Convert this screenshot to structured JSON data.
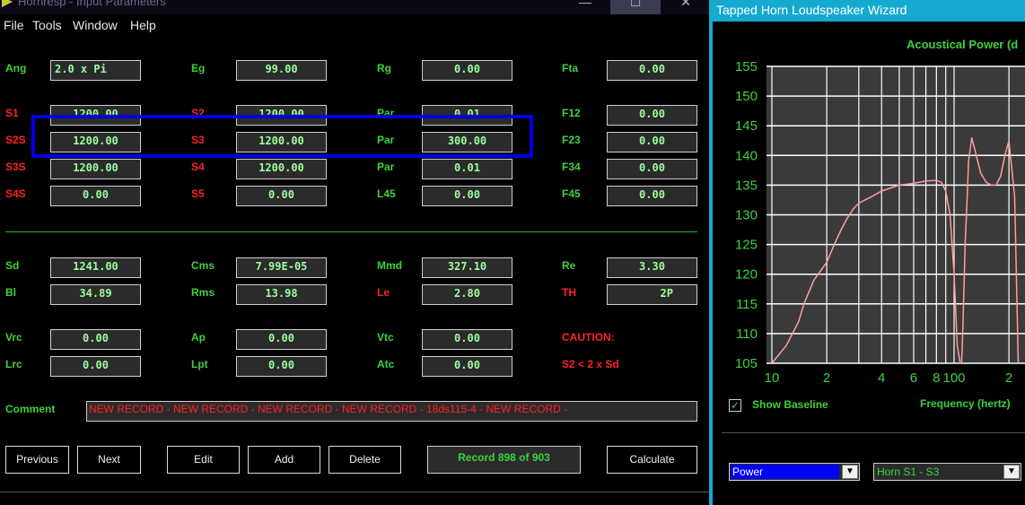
{
  "window": {
    "title": "Hornresp - Input Parameters",
    "min_glyph": "—",
    "max_glyph": "☐",
    "close_glyph": "✕"
  },
  "menu": [
    "File",
    "Tools",
    "Window",
    "Help"
  ],
  "params": {
    "ang": {
      "label": "Ang",
      "value": "2.0 x Pi"
    },
    "eg": {
      "label": "Eg",
      "value": "99.00"
    },
    "rg": {
      "label": "Rg",
      "value": "0.00"
    },
    "fta": {
      "label": "Fta",
      "value": "0.00"
    },
    "s1": {
      "label": "S1",
      "value": "1200.00"
    },
    "s2": {
      "label": "S2",
      "value": "1200.00"
    },
    "par1": {
      "label": "Par",
      "value": "0.01"
    },
    "f12": {
      "label": "F12",
      "value": "0.00"
    },
    "s2s": {
      "label": "S2S",
      "value": "1200.00"
    },
    "s3": {
      "label": "S3",
      "value": "1200.00"
    },
    "par2": {
      "label": "Par",
      "value": "300.00"
    },
    "f23": {
      "label": "F23",
      "value": "0.00"
    },
    "s3s": {
      "label": "S3S",
      "value": "1200.00"
    },
    "s4": {
      "label": "S4",
      "value": "1200.00"
    },
    "par3": {
      "label": "Par",
      "value": "0.01"
    },
    "f34": {
      "label": "F34",
      "value": "0.00"
    },
    "s4s": {
      "label": "S4S",
      "value": "0.00"
    },
    "s5": {
      "label": "S5",
      "value": "0.00"
    },
    "l45": {
      "label": "L45",
      "value": "0.00"
    },
    "f45": {
      "label": "F45",
      "value": "0.00"
    },
    "sd": {
      "label": "Sd",
      "value": "1241.00"
    },
    "cms": {
      "label": "Cms",
      "value": "7.99E-05"
    },
    "mmd": {
      "label": "Mmd",
      "value": "327.10"
    },
    "re": {
      "label": "Re",
      "value": "3.30"
    },
    "bl": {
      "label": "Bl",
      "value": "34.89"
    },
    "rms": {
      "label": "Rms",
      "value": "13.98"
    },
    "le": {
      "label": "Le",
      "value": "2.80"
    },
    "th": {
      "label": "TH",
      "value": "2P"
    },
    "vrc": {
      "label": "Vrc",
      "value": "0.00"
    },
    "ap": {
      "label": "Ap",
      "value": "0.00"
    },
    "vtc": {
      "label": "Vtc",
      "value": "0.00"
    },
    "lrc": {
      "label": "Lrc",
      "value": "0.00"
    },
    "lpt": {
      "label": "Lpt",
      "value": "0.00"
    },
    "atc": {
      "label": "Atc",
      "value": "0.00"
    }
  },
  "caution": {
    "title": "CAUTION:",
    "message": "S2 < 2 x Sd"
  },
  "comment": {
    "label": "Comment",
    "value": "NEW RECORD - NEW RECORD - NEW RECORD - NEW RECORD - 18ds115-4 - NEW RECORD -"
  },
  "buttons": {
    "previous": "Previous",
    "next": "Next",
    "edit": "Edit",
    "add": "Add",
    "delete": "Delete",
    "calculate": "Calculate"
  },
  "record": "Record 898 of 903",
  "wizard": {
    "title": "Tapped Horn Loudspeaker Wizard",
    "chart_title": "Acoustical Power (d",
    "show_baseline": "Show Baseline",
    "show_baseline_checked": true,
    "freq_label": "Frequency (hertz)",
    "select_quantity": "Power",
    "select_horn": "Horn S1 - S3"
  },
  "chart_data": {
    "type": "line",
    "title": "Acoustical Power (d",
    "xlabel": "Frequency (hertz)",
    "ylabel": "",
    "x_scale": "log",
    "grid": true,
    "ylim": [
      105,
      155
    ],
    "y_ticks": [
      155,
      150,
      145,
      140,
      135,
      130,
      125,
      120,
      115,
      110,
      105
    ],
    "x_tick_labels": [
      "10",
      "2",
      "4",
      "6",
      "8",
      "100",
      "2"
    ],
    "line_color": "#ff9c9c",
    "series": [
      {
        "x": [
          10,
          12,
          14,
          15,
          17,
          20,
          22,
          24,
          26,
          28,
          30,
          35,
          40,
          50,
          60,
          70,
          80,
          85,
          90,
          95,
          100,
          104,
          108,
          110,
          112,
          115,
          118,
          120,
          125,
          130,
          140,
          150,
          160,
          170,
          180,
          190,
          200,
          215,
          225
        ],
        "y": [
          105,
          108,
          112,
          115,
          119,
          122,
          125,
          127.5,
          129.5,
          131,
          132,
          133,
          134,
          135,
          135.3,
          135.7,
          135.8,
          135.5,
          134,
          130,
          120,
          108,
          105,
          105,
          112,
          125,
          133,
          139,
          143,
          141,
          137,
          135.5,
          135,
          135,
          136.5,
          140,
          142.5,
          133,
          105
        ]
      }
    ]
  }
}
